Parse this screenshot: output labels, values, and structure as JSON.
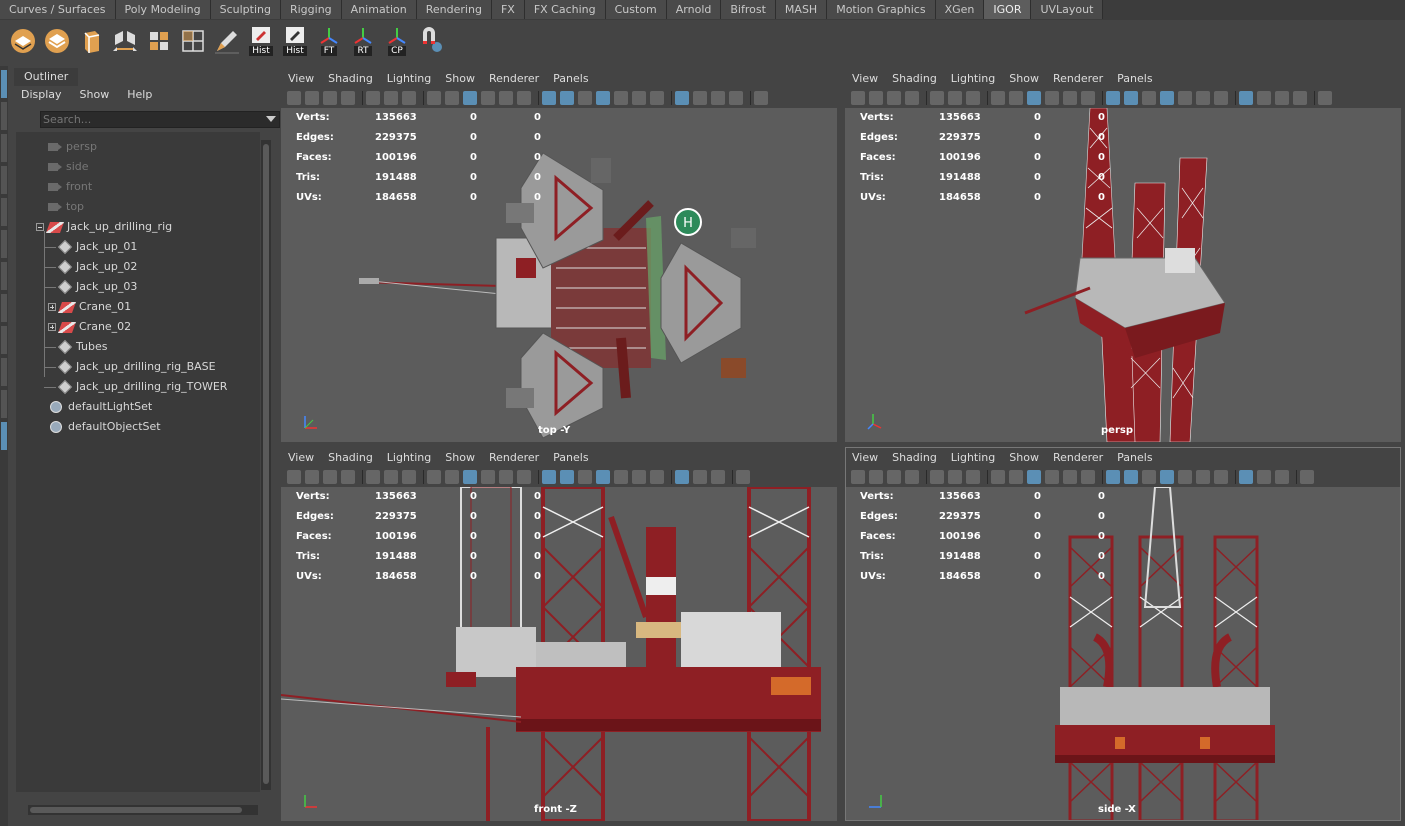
{
  "shelf_tabs": [
    "Curves / Surfaces",
    "Poly Modeling",
    "Sculpting",
    "Rigging",
    "Animation",
    "Rendering",
    "FX",
    "FX Caching",
    "Custom",
    "Arnold",
    "Bifrost",
    "MASH",
    "Motion Graphics",
    "XGen",
    "IGOR",
    "UVLayout"
  ],
  "active_shelf_tab": "IGOR",
  "shelf_buttons": [
    {
      "label": "Hist"
    },
    {
      "label": "Hist"
    },
    {
      "label": "FT"
    },
    {
      "label": "RT"
    },
    {
      "label": "CP"
    }
  ],
  "outliner": {
    "tab": "Outliner",
    "menu": [
      "Display",
      "Show",
      "Help"
    ],
    "search_placeholder": "Search...",
    "cameras": [
      "persp",
      "side",
      "front",
      "top"
    ],
    "group": "Jack_up_drilling_rig",
    "children": [
      "Jack_up_01",
      "Jack_up_02",
      "Jack_up_03",
      "Crane_01",
      "Crane_02",
      "Tubes",
      "Jack_up_drilling_rig_BASE",
      "Jack_up_drilling_rig_TOWER"
    ],
    "sets": [
      "defaultLightSet",
      "defaultObjectSet"
    ]
  },
  "viewport_menu": [
    "View",
    "Shading",
    "Lighting",
    "Show",
    "Renderer",
    "Panels"
  ],
  "hud": {
    "rows": [
      {
        "k": "Verts:",
        "a": "135663",
        "b": "0",
        "c": "0"
      },
      {
        "k": "Edges:",
        "a": "229375",
        "b": "0",
        "c": "0"
      },
      {
        "k": "Faces:",
        "a": "100196",
        "b": "0",
        "c": "0"
      },
      {
        "k": "Tris:",
        "a": "191488",
        "b": "0",
        "c": "0"
      },
      {
        "k": "UVs:",
        "a": "184658",
        "b": "0",
        "c": "0"
      }
    ]
  },
  "viewports": {
    "top": {
      "label": "top -Y"
    },
    "persp": {
      "label": "persp"
    },
    "front": {
      "label": "front -Z"
    },
    "side": {
      "label": "side -X"
    }
  },
  "colors": {
    "accent": "#5b8fb5",
    "rig_red": "#8e1f24",
    "rig_white": "#e6e6e6"
  }
}
